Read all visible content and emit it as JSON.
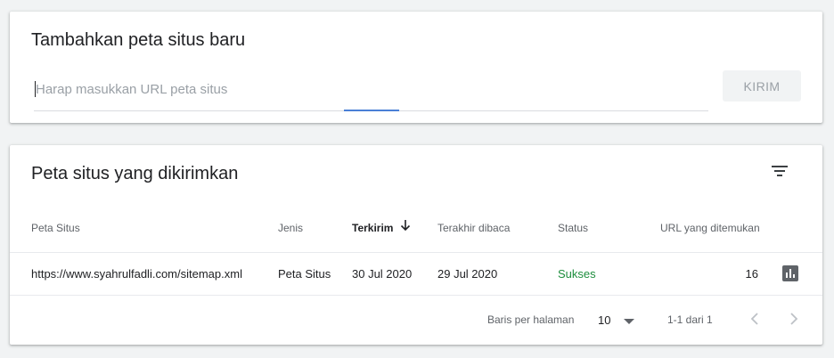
{
  "add_card": {
    "title": "Tambahkan peta situs baru",
    "input_placeholder": "Harap masukkan URL peta situs",
    "input_value": "",
    "submit_label": "KIRIM"
  },
  "list_card": {
    "title": "Peta situs yang dikirimkan",
    "columns": [
      "Peta Situs",
      "Jenis",
      "Terkirim",
      "Terakhir dibaca",
      "Status",
      "URL yang ditemukan"
    ],
    "sorted_column": "Terkirim",
    "sort_direction": "descending",
    "rows": [
      {
        "sitemap": "https://www.syahrulfadli.com/sitemap.xml",
        "type": "Peta Situs",
        "submitted": "30 Jul 2020",
        "last_read": "29 Jul 2020",
        "status": "Sukses",
        "discovered_urls": "16"
      }
    ],
    "pagination": {
      "rows_per_page_label": "Baris per halaman",
      "rows_per_page_value": "10",
      "range_label": "1-1 dari 1"
    }
  },
  "colors": {
    "status_success": "#1e8e3e",
    "focus_accent": "#4a7fd6",
    "page_background": "#f1f3f4"
  },
  "icons": {
    "filter": "filter-icon",
    "sort": "arrow-down-icon",
    "report": "bar-chart-icon",
    "dropdown": "caret-down-icon",
    "prev": "chevron-left-icon",
    "next": "chevron-right-icon"
  }
}
